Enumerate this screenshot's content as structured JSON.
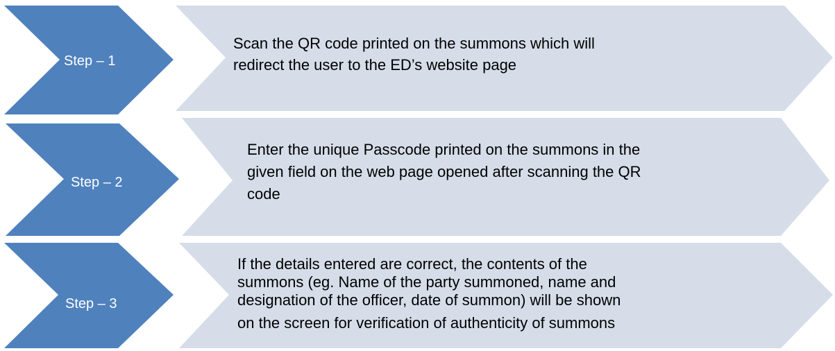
{
  "colors": {
    "chevron": "#4f81bd",
    "panel": "#d6dde9"
  },
  "steps": [
    {
      "label": "Step – 1",
      "lines": [
        "Scan the QR code printed on the summons which will",
        "redirect the user to the ED’s website page"
      ]
    },
    {
      "label": "Step – 2",
      "lines": [
        "Enter the unique Passcode printed on the summons in the",
        "given field on the web page opened after scanning the QR",
        "code"
      ]
    },
    {
      "label": "Step – 3",
      "lines": [
        "If the details entered are correct, the contents of the",
        "summons (eg. Name of the party summoned, name and",
        "designation of the officer, date of summon) will be shown",
        "on the screen for verification of authenticity of summons"
      ]
    }
  ]
}
